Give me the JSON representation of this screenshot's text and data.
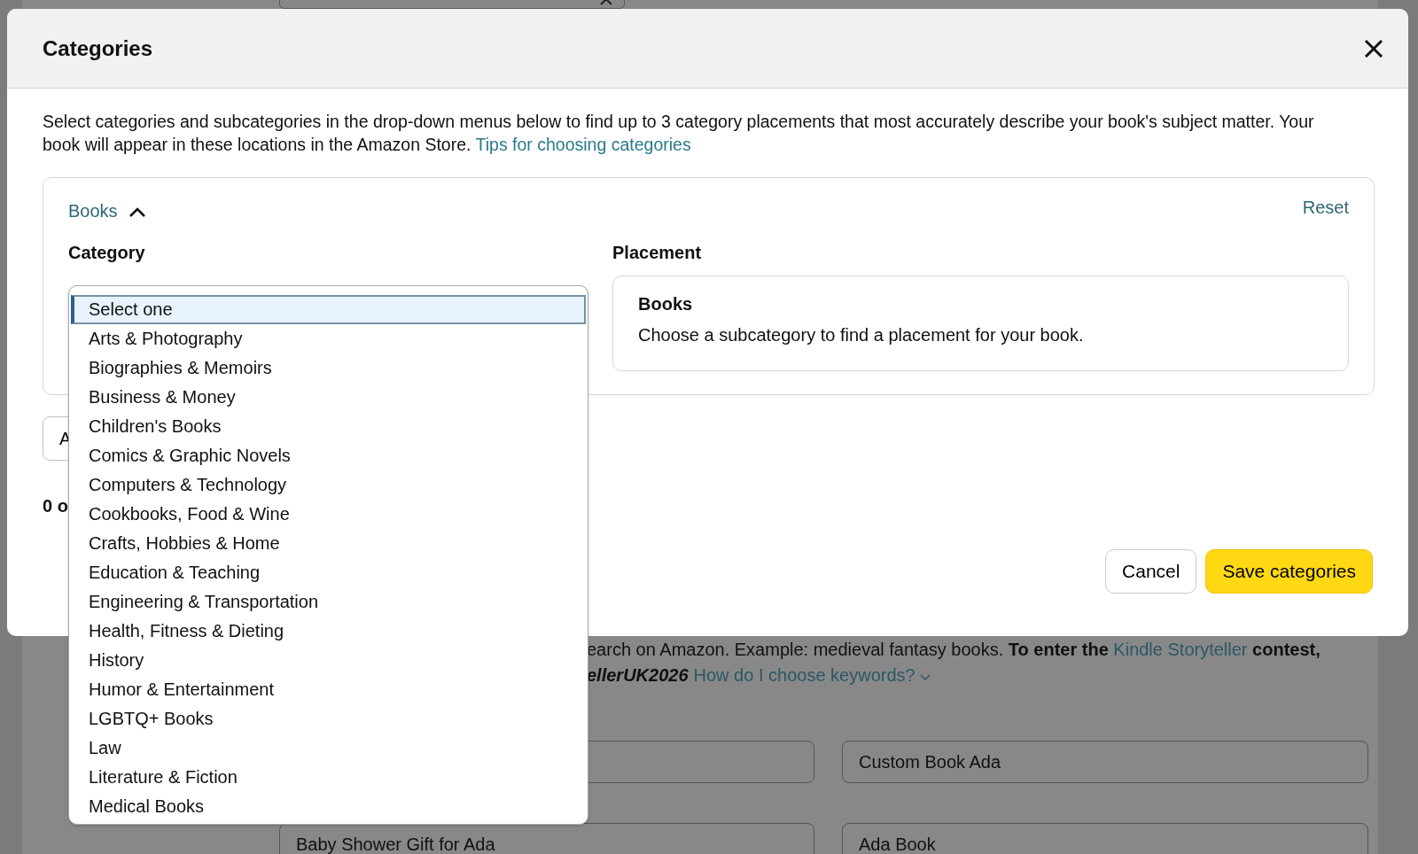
{
  "background": {
    "keywords_text": {
      "line_1": "earch on Amazon. Example: medieval fantasy books. **To enter the** ",
      "line_1_link": "Kindle Storyteller",
      "line_1_end": " contest,",
      "line_2": "ellerUK2026",
      "line_2_link": "How do I choose keywords?"
    },
    "keyword_fields": [
      {
        "value": "Custom Book Ada"
      },
      {
        "value": "Baby Shower Gift for Ada"
      },
      {
        "value": "Ada Book"
      }
    ]
  },
  "dialog": {
    "title": "Categories",
    "intro": "Select categories and subcategories in the drop-down menus below to find up to 3 category placements that most accurately describe your book's subject matter. Your book will appear in these locations in the Amazon Store. ",
    "intro_link": "Tips for choosing categories",
    "section": {
      "label": "Books",
      "expanded": true,
      "reset": "Reset",
      "category_label": "Category",
      "placement_label": "Placement",
      "placement": {
        "title": "Books",
        "text": "Choose a subcategory to find a placement for your book."
      }
    },
    "hidden_button": "A",
    "count_text": "0 o",
    "category_options": [
      {
        "label": "Select one",
        "selected": true
      },
      {
        "label": "Arts & Photography",
        "selected": false
      },
      {
        "label": "Biographies & Memoirs",
        "selected": false
      },
      {
        "label": "Business & Money",
        "selected": false
      },
      {
        "label": "Children's Books",
        "selected": false
      },
      {
        "label": "Comics & Graphic Novels",
        "selected": false
      },
      {
        "label": "Computers & Technology",
        "selected": false
      },
      {
        "label": "Cookbooks, Food & Wine",
        "selected": false
      },
      {
        "label": "Crafts, Hobbies & Home",
        "selected": false
      },
      {
        "label": "Education & Teaching",
        "selected": false
      },
      {
        "label": "Engineering & Transportation",
        "selected": false
      },
      {
        "label": "Health, Fitness & Dieting",
        "selected": false
      },
      {
        "label": "History",
        "selected": false
      },
      {
        "label": "Humor & Entertainment",
        "selected": false
      },
      {
        "label": "LGBTQ+ Books",
        "selected": false
      },
      {
        "label": "Law",
        "selected": false
      },
      {
        "label": "Literature & Fiction",
        "selected": false
      },
      {
        "label": "Medical Books",
        "selected": false
      }
    ],
    "buttons": {
      "cancel": "Cancel",
      "save": "Save categories"
    }
  }
}
